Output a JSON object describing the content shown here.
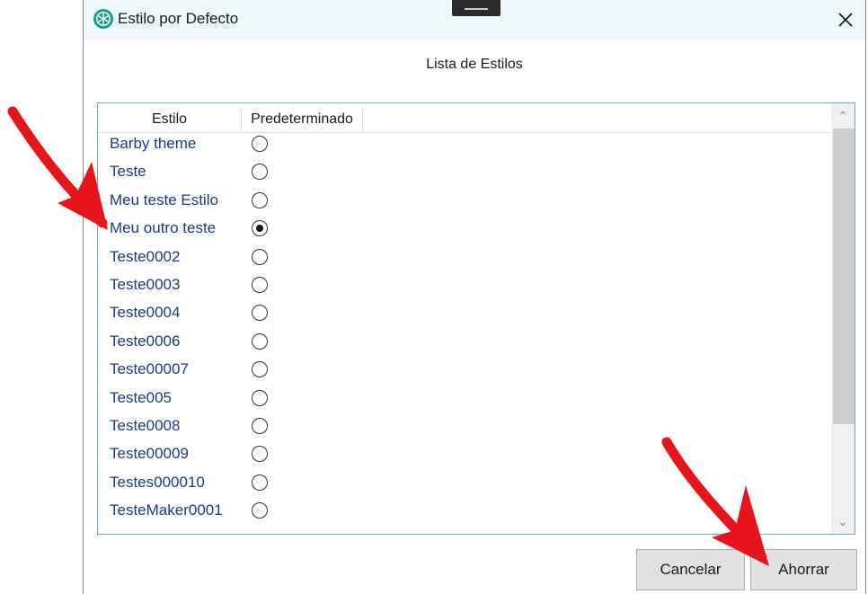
{
  "window": {
    "title": "Estilo por Defecto",
    "close_label": "close"
  },
  "list_title": "Lista de Estilos",
  "table": {
    "columns": [
      "Estilo",
      "Predeterminado"
    ],
    "rows": [
      {
        "name": "Barby theme",
        "default": false
      },
      {
        "name": "Teste",
        "default": false
      },
      {
        "name": "Meu teste Estilo",
        "default": false
      },
      {
        "name": "Meu outro teste",
        "default": true
      },
      {
        "name": "Teste0002",
        "default": false
      },
      {
        "name": "Teste0003",
        "default": false
      },
      {
        "name": "Teste0004",
        "default": false
      },
      {
        "name": "Teste0006",
        "default": false
      },
      {
        "name": "Teste00007",
        "default": false
      },
      {
        "name": "Teste005",
        "default": false
      },
      {
        "name": "Teste0008",
        "default": false
      },
      {
        "name": "Teste00009",
        "default": false
      },
      {
        "name": "Testes000010",
        "default": false
      },
      {
        "name": "TesteMaker0001",
        "default": false
      }
    ]
  },
  "buttons": {
    "cancel": "Cancelar",
    "save": "Ahorrar"
  },
  "colors": {
    "accent": "#1a9e8f",
    "row_text": "#1f3a80",
    "annotation": "#e8141b"
  },
  "icons": {
    "app": "lime-slice-icon",
    "close": "close-icon"
  }
}
